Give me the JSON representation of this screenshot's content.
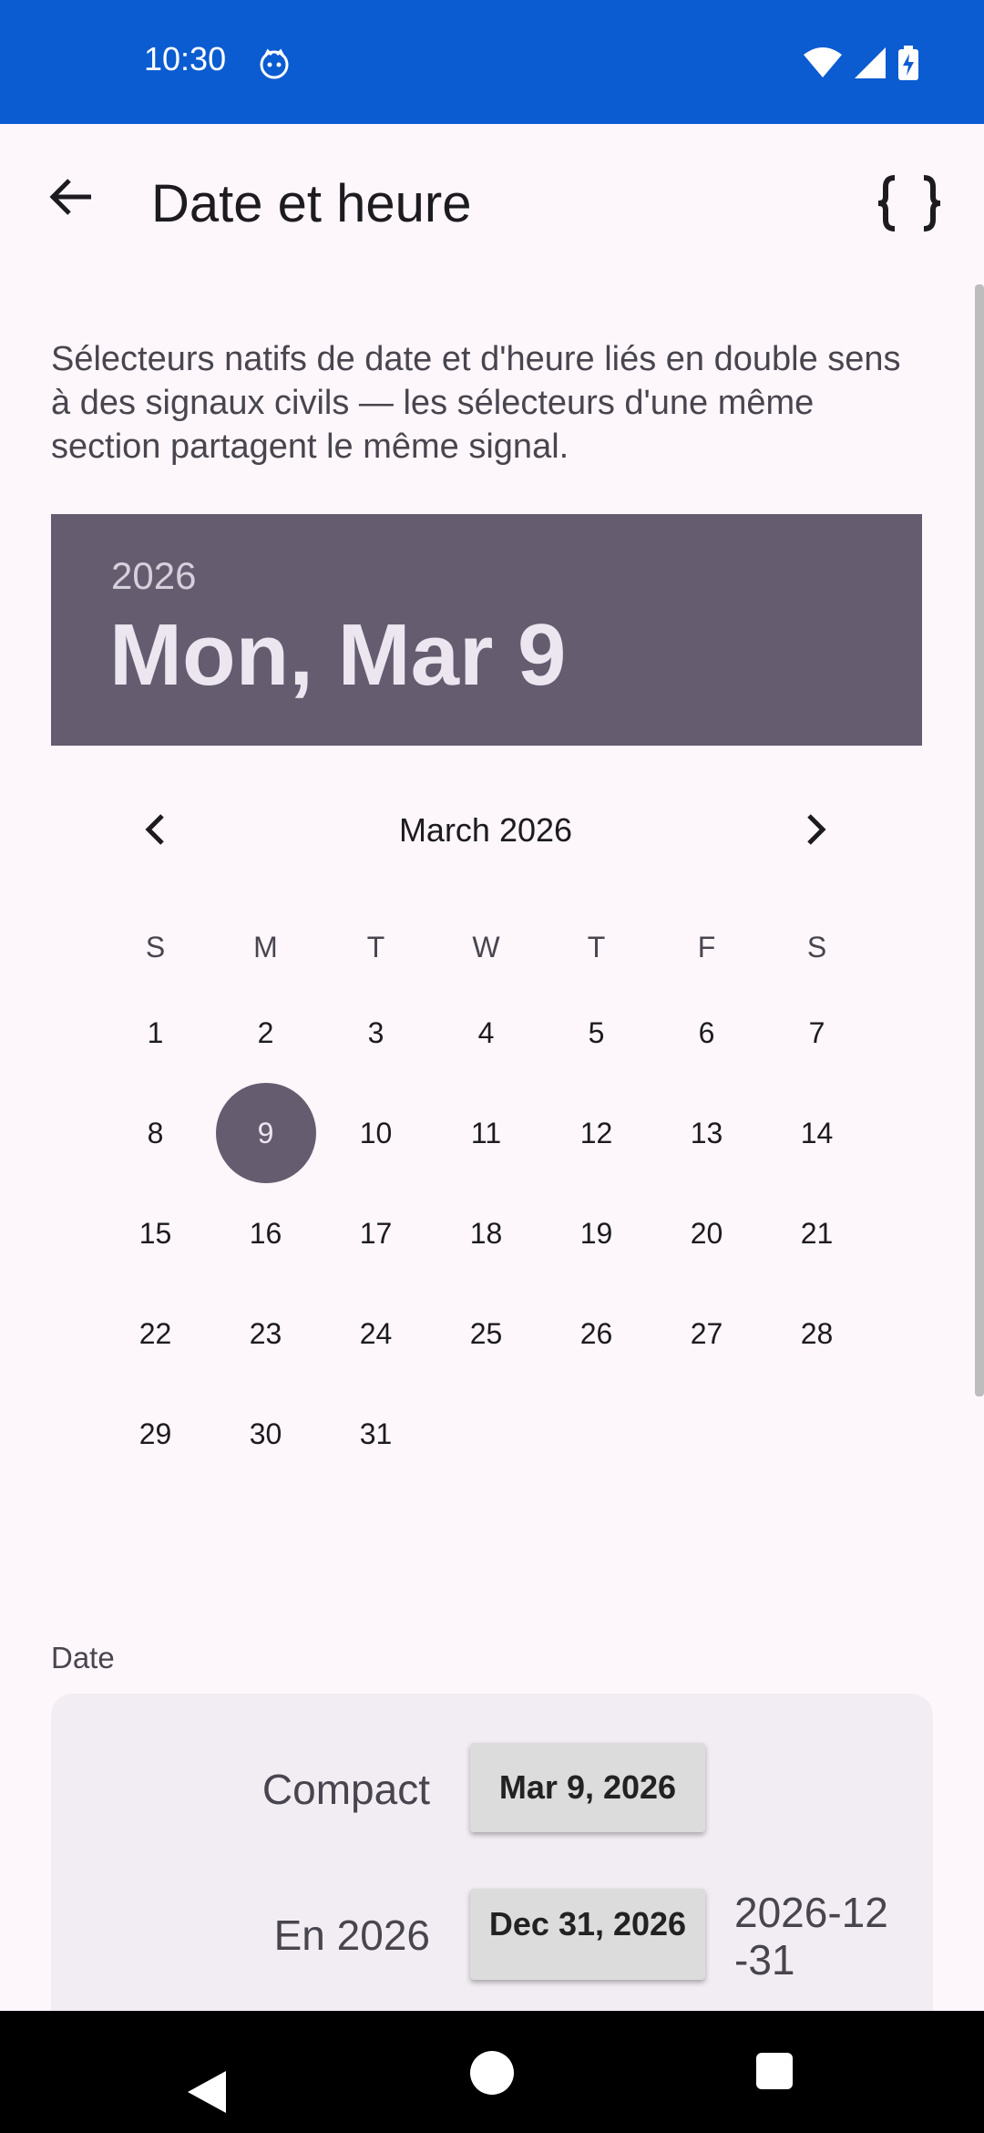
{
  "status": {
    "time": "10:30"
  },
  "app_bar": {
    "title": "Date et heure"
  },
  "intro": "Sélecteurs natifs de date et d'heure liés en double sens à des signaux civils — les sélecteurs d'une même section partagent le même signal.",
  "picker": {
    "year": "2026",
    "selected_date": "Mon, Mar 9",
    "month_label": "March 2026",
    "weekdays": [
      "S",
      "M",
      "T",
      "W",
      "T",
      "F",
      "S"
    ],
    "weeks": [
      [
        "1",
        "2",
        "3",
        "4",
        "5",
        "6",
        "7"
      ],
      [
        "8",
        "9",
        "10",
        "11",
        "12",
        "13",
        "14"
      ],
      [
        "15",
        "16",
        "17",
        "18",
        "19",
        "20",
        "21"
      ],
      [
        "22",
        "23",
        "24",
        "25",
        "26",
        "27",
        "28"
      ],
      [
        "29",
        "30",
        "31",
        "",
        "",
        "",
        ""
      ]
    ],
    "selected_day": "9",
    "accent": "#655c70"
  },
  "date_section": {
    "label": "Date",
    "rows": [
      {
        "label": "Compact",
        "value": "Mar 9, 2026"
      },
      {
        "label": "En 2026",
        "value": "Dec 31, 2026",
        "iso": "2026-12 -31"
      }
    ]
  },
  "colors": {
    "status_bar": "#0b5bd1",
    "background": "#fdf7fb",
    "card": "#f1edf3"
  }
}
